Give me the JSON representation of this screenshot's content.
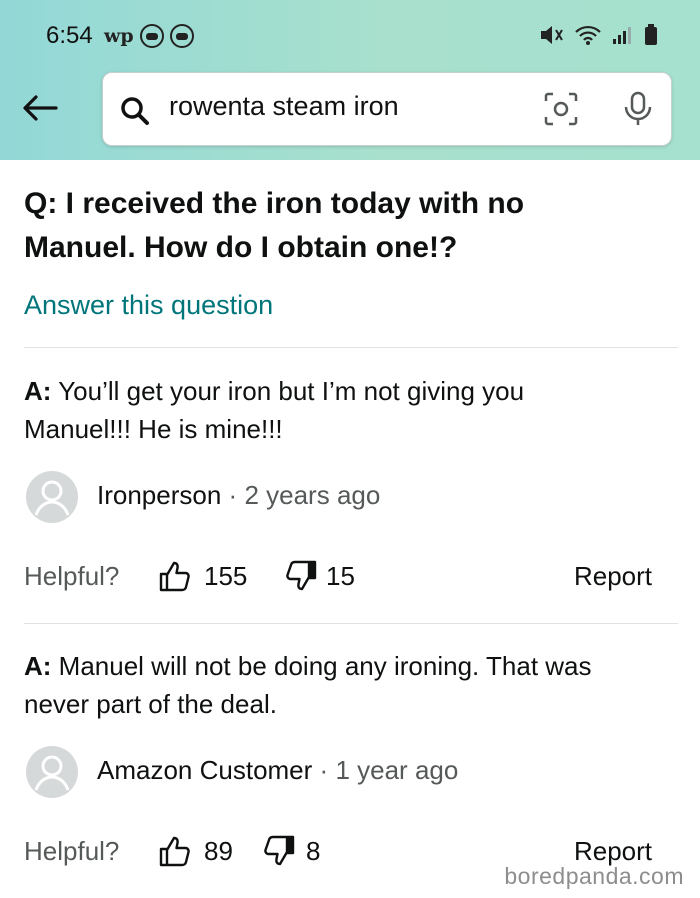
{
  "status_bar": {
    "time": "6:54",
    "app_badge": "wp"
  },
  "search": {
    "query": "rowenta steam iron"
  },
  "question": {
    "prefix": "Q:",
    "line1": "I received the iron today with no",
    "line2": "Manuel. How do I obtain one!?",
    "answer_link": "Answer this question"
  },
  "answers": [
    {
      "prefix": "A:",
      "line1": "You’ll get your iron but I’m not giving you",
      "line2": "Manuel!!! He is mine!!!",
      "author": "Ironperson",
      "separator": "·",
      "time_ago": "2 years ago",
      "helpful_label": "Helpful?",
      "up_count": "155",
      "down_count": "15",
      "report_label": "Report"
    },
    {
      "prefix": "A:",
      "line1": "Manuel will not be doing any ironing. That was",
      "line2": "never part of the deal.",
      "author": "Amazon Customer",
      "separator": "·",
      "time_ago": "1 year ago",
      "helpful_label": "Helpful?",
      "up_count": "89",
      "down_count": "8",
      "report_label": "Report"
    }
  ],
  "watermark": "boredpanda.com",
  "colors": {
    "header_gradient_start": "#93d8d7",
    "header_gradient_end": "#a6e1cf",
    "link": "#00767a",
    "muted": "#565959"
  }
}
